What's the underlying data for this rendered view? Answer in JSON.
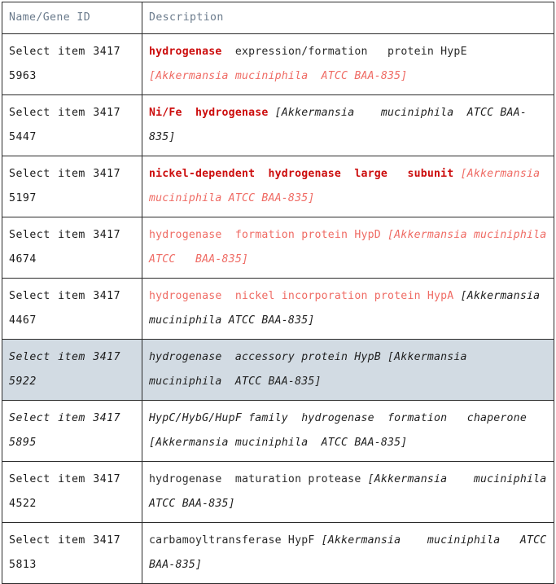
{
  "table": {
    "headers": {
      "name": "Name/Gene ID",
      "description": "Description"
    },
    "colors": {
      "border": "#2b2b2b",
      "header_text": "#6b7b8c",
      "highlight_row_bg": "#d2dbe3",
      "bold_red": "#cc0d0d",
      "light_red": "#ef6b64",
      "body_text": "#1a1a1a"
    },
    "rows": [
      {
        "select_label": "Select item 3417",
        "gene_id": "5963",
        "highlighted": false,
        "name_italic": false,
        "description_plain": "hydrogenase expression/formation  protein HypE [Akkermansia muciniphila  ATCC BAA-835]",
        "runs": [
          {
            "text": "hydrogenase",
            "style": "bold-red"
          },
          {
            "text": "  expression/formation   protein HypE ",
            "style": "plain"
          },
          {
            "text": "[Akkermansia muciniphila  ATCC BAA-835]",
            "style": "light-red-italic"
          }
        ]
      },
      {
        "select_label": "Select item 3417",
        "gene_id": "5447",
        "highlighted": false,
        "name_italic": false,
        "description_plain": "Ni/Fe hydrogenase [Akkermansia  muciniphila ATCC BAA-835]",
        "runs": [
          {
            "text": "Ni/Fe  hydrogenase",
            "style": "bold-red"
          },
          {
            "text": " ",
            "style": "plain"
          },
          {
            "text": "[Akkermansia    muciniphila  ATCC BAA-835]",
            "style": "italic"
          }
        ]
      },
      {
        "select_label": "Select item 3417",
        "gene_id": "5197",
        "highlighted": false,
        "name_italic": false,
        "description_plain": "nickel-dependent hydrogenase large  subunit [Akkermansia muciniphila ATCC BAA-835]",
        "runs": [
          {
            "text": "nickel-dependent  hydrogenase  large   subunit ",
            "style": "bold-red"
          },
          {
            "text": "[Akkermansia muciniphila ATCC BAA-835]",
            "style": "light-red-italic"
          }
        ]
      },
      {
        "select_label": "Select item 3417",
        "gene_id": "4674",
        "highlighted": false,
        "name_italic": false,
        "description_plain": "hydrogenase formation protein HypD [Akkermansia muciniphila  ATCC  BAA-835]",
        "runs": [
          {
            "text": "hydrogenase  formation protein HypD ",
            "style": "light-red"
          },
          {
            "text": "[Akkermansia muciniphila  ATCC   BAA-835]",
            "style": "light-red-italic"
          }
        ]
      },
      {
        "select_label": "Select item 3417",
        "gene_id": "4467",
        "highlighted": false,
        "name_italic": false,
        "description_plain": "hydrogenase nickel incorporation protein HypA [Akkermansia  muciniphila ATCC BAA-835]",
        "runs": [
          {
            "text": "hydrogenase  nickel incorporation protein HypA ",
            "style": "light-red"
          },
          {
            "text": "[Akkermansia   muciniphila ATCC BAA-835]",
            "style": "italic"
          }
        ]
      },
      {
        "select_label": "Select item 3417",
        "gene_id": "5922",
        "highlighted": true,
        "name_italic": true,
        "description_plain": "hydrogenase accessory protein HypB [Akkermansia  muciniphila  ATCC BAA-835]",
        "runs": [
          {
            "text": "hydrogenase  accessory protein HypB [Akkermansia   muciniphila  ATCC BAA-835]",
            "style": "italic"
          }
        ]
      },
      {
        "select_label": "Select item 3417",
        "gene_id": "5895",
        "highlighted": false,
        "name_italic": true,
        "description_plain": "HypC/HybG/HupF family hydrogenase formation  chaperone [Akkermansia muciniphila  ATCC BAA-835]",
        "runs": [
          {
            "text": "HypC/HybG/HupF family  hydrogenase  formation   chaperone [Akkermansia muciniphila  ATCC BAA-835]",
            "style": "italic"
          }
        ]
      },
      {
        "select_label": "Select item 3417",
        "gene_id": "4522",
        "highlighted": false,
        "name_italic": false,
        "description_plain": "hydrogenase maturation protease [Akkermansia  muciniphila  ATCC BAA-835]",
        "runs": [
          {
            "text": "hydrogenase  maturation protease ",
            "style": "plain"
          },
          {
            "text": "[Akkermansia    muciniphila  ATCC BAA-835]",
            "style": "italic"
          }
        ]
      },
      {
        "select_label": "Select item 3417",
        "gene_id": "5813",
        "highlighted": false,
        "name_italic": false,
        "description_plain": "carbamoyltransferase HypF [Akkermansia  muciniphila  ATCC BAA-835]",
        "runs": [
          {
            "text": "carbamoyltransferase HypF ",
            "style": "plain"
          },
          {
            "text": "[Akkermansia    muciniphila   ATCC BAA-835]",
            "style": "italic"
          }
        ]
      }
    ]
  }
}
